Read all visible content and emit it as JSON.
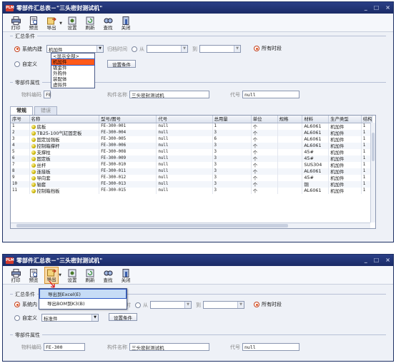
{
  "window1": {
    "title": "零部件汇总表－\"三头密封测试机\"",
    "window_buttons": [
      "_",
      "□",
      "×"
    ],
    "toolbar": [
      {
        "label": "打印",
        "icon": "printer-icon"
      },
      {
        "label": "预览",
        "icon": "preview-icon"
      },
      {
        "label": "导出",
        "icon": "export-icon"
      },
      {
        "label": "设置",
        "icon": "settings-icon"
      },
      {
        "label": "刷新",
        "icon": "refresh-icon"
      },
      {
        "label": "查找",
        "icon": "find-icon"
      },
      {
        "label": "关闭",
        "icon": "close-icon"
      }
    ],
    "summary_conditions": {
      "section_title": "汇总条件",
      "builtin_label": "系统内建",
      "builtin_value": "机加件",
      "archive_time_label": "归档时间",
      "from_label": "从",
      "to_label": "到",
      "all_time_label": "所有时段",
      "custom_label": "自定义",
      "set_condition_button": "设置条件",
      "dropdown_options": [
        "<显示全部>",
        "机加件",
        "钣金件",
        "外购件",
        "装配体",
        "虚拟件"
      ],
      "dropdown_selected_index": 1
    },
    "part_attributes": {
      "section_title": "零部件属性",
      "code_label": "物料编码",
      "code_value": "FE",
      "name_label": "构件名称",
      "name_value": "三头密封测试机",
      "id_label": "代号",
      "id_value": "null"
    },
    "tabs": [
      "常规",
      "错误"
    ],
    "table": {
      "columns": [
        "序号",
        "名称",
        "型号/图号",
        "代号",
        "总用量",
        "单位",
        "规格",
        "材料",
        "生产类型",
        "结构"
      ],
      "rows": [
        [
          "1",
          "底板",
          "FE-300-001",
          "null",
          "1",
          "个",
          "",
          "AL6061",
          "机加件",
          "1"
        ],
        [
          "2",
          "TB25-100气缸固定板",
          "FE-300-004",
          "null",
          "3",
          "个",
          "",
          "AL6061",
          "机加件",
          "1"
        ],
        [
          "3",
          "固定加强板",
          "FE-300-005",
          "null",
          "6",
          "个",
          "",
          "AL6061",
          "机加件",
          "1"
        ],
        [
          "4",
          "控制箱撑杆",
          "FE-300-006",
          "null",
          "3",
          "个",
          "",
          "AL6061",
          "机加件",
          "1"
        ],
        [
          "5",
          "支撑柱",
          "FE-300-008",
          "null",
          "3",
          "个",
          "",
          "45#",
          "机加件",
          "1"
        ],
        [
          "6",
          "固定板",
          "FE-300-009",
          "null",
          "3",
          "个",
          "",
          "45#",
          "机加件",
          "1"
        ],
        [
          "7",
          "丝杆",
          "FE-300-010",
          "null",
          "3",
          "个",
          "",
          "SUS304",
          "机加件",
          "1"
        ],
        [
          "8",
          "连接板",
          "FE-300-011",
          "null",
          "3",
          "个",
          "",
          "AL6061",
          "机加件",
          "1"
        ],
        [
          "9",
          "导向套",
          "FE-300-012",
          "null",
          "3",
          "个",
          "",
          "45#",
          "机加件",
          "1"
        ],
        [
          "10",
          "轴套",
          "FE-300-013",
          "null",
          "3",
          "个",
          "",
          "铜",
          "机加件",
          "1"
        ],
        [
          "11",
          "控制箱挡板",
          "FE-300-015",
          "null",
          "3",
          "个",
          "",
          "AL6061",
          "机加件",
          "1"
        ]
      ]
    }
  },
  "window2": {
    "title": "零部件汇总表－\"三头密封测试机\"",
    "window_buttons": [
      "_",
      "□",
      "×"
    ],
    "export_menu": [
      "导出到Excel(E)",
      "导出BOM到K3(B)"
    ],
    "summary_conditions": {
      "section_title": "汇总条件",
      "builtin_label": "系统内",
      "archive_time_label": "时",
      "from_label": "从",
      "to_label": "到",
      "all_time_label": "所有时段",
      "custom_label": "自定义",
      "custom_value": "标准件",
      "set_condition_button": "设置条件"
    },
    "part_attributes": {
      "section_title": "零部件属性",
      "code_label": "物料编码",
      "code_value": "FE-300",
      "name_label": "构件名称",
      "name_value": "三头密封测试机",
      "id_label": "代号",
      "id_value": "null"
    }
  }
}
